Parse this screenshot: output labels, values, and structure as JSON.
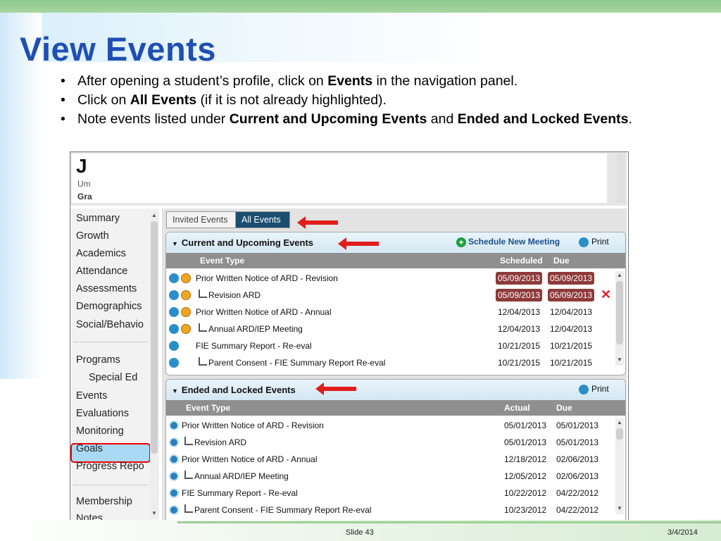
{
  "slide": {
    "title": "View Events",
    "bullets": [
      {
        "pre": "After opening a student’s profile, click on ",
        "bold": "Events",
        "post": " in the navigation panel.",
        "bold2": "",
        "post2": ""
      },
      {
        "pre": "Click on ",
        "bold": "All Events",
        "post": " (if it is not already highlighted).",
        "bold2": "",
        "post2": ""
      },
      {
        "pre": "Note events listed under ",
        "bold": "Current and Upcoming Events",
        "post": " and ",
        "bold2": "Ended and Locked Events",
        "post2": "."
      }
    ],
    "footer": {
      "slide_label": "Slide 43",
      "date": "3/4/2014"
    }
  },
  "header": {
    "initial": "J",
    "line2": "Um",
    "line3": "Gra"
  },
  "nav": {
    "items": [
      "Summary",
      "Growth",
      "Academics",
      "Attendance",
      "Assessments",
      "Demographics",
      "Social/Behavio",
      "Programs",
      "Special Ed",
      "Events",
      "Evaluations",
      "Monitoring",
      "Goals",
      "Progress Repo",
      "Membership",
      "Notes"
    ],
    "selected": "Events"
  },
  "tabs": {
    "invited": "Invited Events",
    "all": "All Events",
    "active": "All Events"
  },
  "current": {
    "title": "Current and Upcoming Events",
    "schedule_label": "Schedule New Meeting",
    "print_label": "Print",
    "columns": {
      "type": "Event Type",
      "scheduled": "Scheduled",
      "due": "Due"
    },
    "rows": [
      {
        "icons": "both",
        "indent": false,
        "type": "Prior Written Notice of ARD -  Revision",
        "scheduled": "05/09/2013",
        "due": "05/09/2013",
        "overdue": true,
        "deletable": false
      },
      {
        "icons": "both",
        "indent": true,
        "type": "Revision ARD",
        "scheduled": "05/09/2013",
        "due": "05/09/2013",
        "overdue": true,
        "deletable": true
      },
      {
        "icons": "both",
        "indent": false,
        "type": "Prior Written Notice of ARD -  Annual",
        "scheduled": "12/04/2013",
        "due": "12/04/2013",
        "overdue": false,
        "deletable": false
      },
      {
        "icons": "both",
        "indent": true,
        "type": "Annual ARD/IEP Meeting",
        "scheduled": "12/04/2013",
        "due": "12/04/2013",
        "overdue": false,
        "deletable": false
      },
      {
        "icons": "single",
        "indent": false,
        "type": "FIE Summary Report - Re-eval",
        "scheduled": "10/21/2015",
        "due": "10/21/2015",
        "overdue": false,
        "deletable": false
      },
      {
        "icons": "single",
        "indent": true,
        "type": "Parent Consent  - FIE Summary Report Re-eval",
        "scheduled": "10/21/2015",
        "due": "10/21/2015",
        "overdue": false,
        "deletable": false
      }
    ]
  },
  "ended": {
    "title": "Ended and Locked Events",
    "print_label": "Print",
    "columns": {
      "type": "Event Type",
      "actual": "Actual",
      "due": "Due"
    },
    "rows": [
      {
        "indent": false,
        "type": "Prior Written Notice of ARD -  Revision",
        "actual": "05/01/2013",
        "due": "05/01/2013"
      },
      {
        "indent": true,
        "type": "Revision ARD",
        "actual": "05/01/2013",
        "due": "05/01/2013"
      },
      {
        "indent": false,
        "type": "Prior Written Notice of ARD -  Annual",
        "actual": "12/18/2012",
        "due": "02/06/2013"
      },
      {
        "indent": true,
        "type": "Annual ARD/IEP Meeting",
        "actual": "12/05/2012",
        "due": "02/06/2013"
      },
      {
        "indent": false,
        "type": "FIE Summary Report - Re-eval",
        "actual": "10/22/2012",
        "due": "04/22/2012"
      },
      {
        "indent": true,
        "type": "Parent Consent  - FIE Summary Report Re-eval",
        "actual": "10/23/2012",
        "due": "04/22/2012"
      }
    ]
  },
  "colors": {
    "title": "#1f4eb4",
    "highlight_border": "#e00000",
    "overdue": "#8e3a3a",
    "active_tab": "#1b4d70"
  }
}
